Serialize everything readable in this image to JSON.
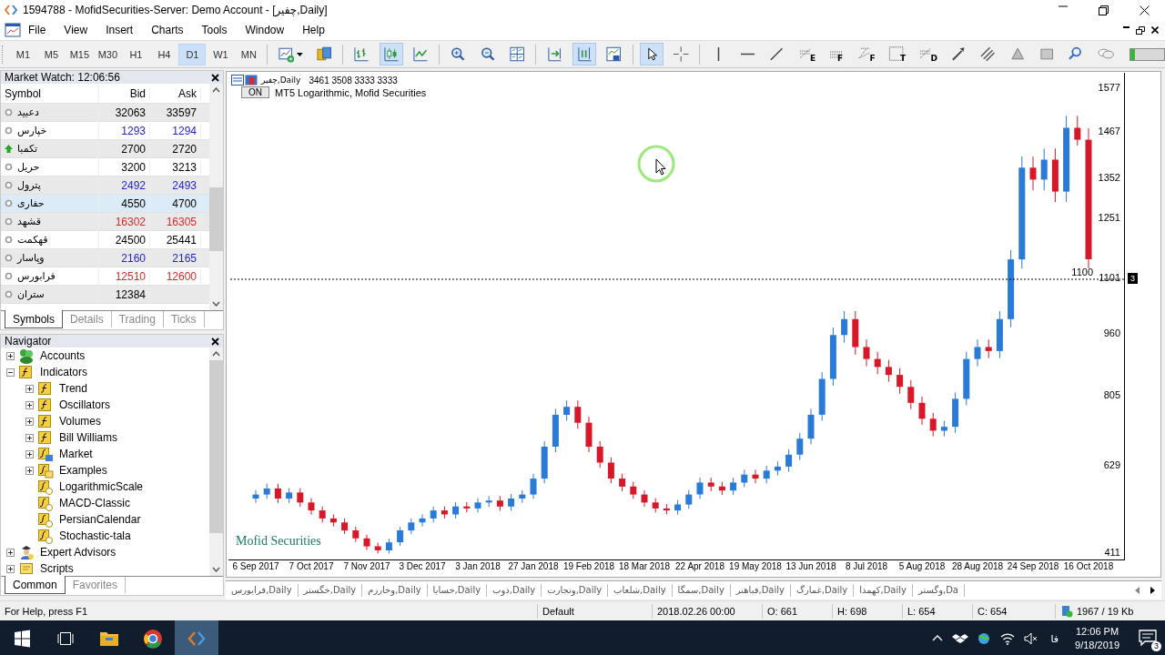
{
  "window": {
    "title": "1594788 - MofidSecurities-Server: Demo Account - [چفیر,Daily]"
  },
  "menu": [
    "File",
    "View",
    "Insert",
    "Charts",
    "Tools",
    "Window",
    "Help"
  ],
  "timeframes": [
    {
      "label": "M1",
      "selected": false
    },
    {
      "label": "M5",
      "selected": false
    },
    {
      "label": "M15",
      "selected": false
    },
    {
      "label": "M30",
      "selected": false
    },
    {
      "label": "H1",
      "selected": false
    },
    {
      "label": "H4",
      "selected": false
    },
    {
      "label": "D1",
      "selected": true
    },
    {
      "label": "W1",
      "selected": false
    },
    {
      "label": "MN",
      "selected": false
    }
  ],
  "toolbar_groups": [
    [
      {
        "kind": "new-chart",
        "selected": false
      },
      {
        "kind": "profiles",
        "selected": false
      }
    ],
    [
      {
        "kind": "bar-chart",
        "selected": false
      },
      {
        "kind": "candle-chart",
        "selected": true
      },
      {
        "kind": "line-chart",
        "selected": false
      }
    ],
    [
      {
        "kind": "zoom-in",
        "selected": false
      },
      {
        "kind": "zoom-out",
        "selected": false
      },
      {
        "kind": "tile",
        "selected": false
      }
    ],
    [
      {
        "kind": "shift",
        "selected": false
      },
      {
        "kind": "autoscroll",
        "selected": true
      },
      {
        "kind": "template",
        "selected": false
      }
    ],
    [
      {
        "kind": "cursor",
        "selected": true
      },
      {
        "kind": "crosshair",
        "selected": false
      }
    ],
    [
      {
        "kind": "vline",
        "selected": false
      },
      {
        "kind": "hline",
        "selected": false
      },
      {
        "kind": "trendline",
        "selected": false
      },
      {
        "kind": "fibo",
        "letter": "E",
        "selected": false
      },
      {
        "kind": "fibo-grid",
        "letter": "F",
        "selected": false
      },
      {
        "kind": "fibo-fan",
        "letter": "F",
        "selected": false
      },
      {
        "kind": "text",
        "letter": "T",
        "selected": false
      },
      {
        "kind": "fibo",
        "letter": "D",
        "selected": false
      },
      {
        "kind": "arrow",
        "selected": false
      },
      {
        "kind": "channel",
        "selected": false
      },
      {
        "kind": "triangle",
        "selected": false
      },
      {
        "kind": "rectangle",
        "selected": false
      },
      {
        "kind": "search",
        "selected": false
      },
      {
        "kind": "chat",
        "selected": false
      }
    ]
  ],
  "market_watch": {
    "title": "Market Watch: 12:06:56",
    "columns": [
      "Symbol",
      "Bid",
      "Ask"
    ],
    "rows": [
      {
        "symbol": "دعبید",
        "bid": "32063",
        "ask": "33597",
        "color": "#000000",
        "kind": "dot",
        "selected": false
      },
      {
        "symbol": "خپارس",
        "bid": "1293",
        "ask": "1294",
        "color": "#2424c8",
        "kind": "dot",
        "selected": false
      },
      {
        "symbol": "تکمبا",
        "bid": "2700",
        "ask": "2720",
        "color": "#000000",
        "kind": "arrow",
        "selected": false
      },
      {
        "symbol": "حریل",
        "bid": "3200",
        "ask": "3213",
        "color": "#000000",
        "kind": "dot",
        "selected": false
      },
      {
        "symbol": "پترول",
        "bid": "2492",
        "ask": "2493",
        "color": "#2424c8",
        "kind": "dot",
        "selected": false
      },
      {
        "symbol": "حفاری",
        "bid": "4550",
        "ask": "4700",
        "color": "#000000",
        "kind": "dot",
        "selected": true
      },
      {
        "symbol": "قشهد",
        "bid": "16302",
        "ask": "16305",
        "color": "#dc2828",
        "kind": "dot",
        "selected": false
      },
      {
        "symbol": "قهکمت",
        "bid": "24500",
        "ask": "25441",
        "color": "#000000",
        "kind": "dot",
        "selected": false
      },
      {
        "symbol": "وپاسار",
        "bid": "2160",
        "ask": "2165",
        "color": "#2424c8",
        "kind": "dot",
        "selected": false
      },
      {
        "symbol": "فرابورس",
        "bid": "12510",
        "ask": "12600",
        "color": "#dc2828",
        "kind": "dot",
        "selected": false
      },
      {
        "symbol": "ستران",
        "bid": "12384",
        "color": "#000000",
        "kind": "dot",
        "selected": false
      }
    ],
    "tabs": [
      {
        "label": "Symbols",
        "selected": true
      },
      {
        "label": "Details",
        "selected": false
      },
      {
        "label": "Trading",
        "selected": false
      },
      {
        "label": "Ticks",
        "selected": false
      }
    ]
  },
  "navigator": {
    "title": "Navigator",
    "items": [
      {
        "label": "Accounts",
        "kind": "accounts",
        "expanded": false
      },
      {
        "label": "Indicators",
        "kind": "indicator",
        "expanded": true,
        "children": [
          {
            "label": "Trend",
            "kind": "indicator",
            "expanded": false
          },
          {
            "label": "Oscillators",
            "kind": "indicator",
            "expanded": false
          },
          {
            "label": "Volumes",
            "kind": "indicator",
            "expanded": false
          },
          {
            "label": "Bill Williams",
            "kind": "indicator",
            "expanded": false
          },
          {
            "label": "Market",
            "kind": "market",
            "expanded": false
          },
          {
            "label": "Examples",
            "kind": "folder",
            "expanded": false
          },
          {
            "label": "LogarithmicScale",
            "kind": "custom"
          },
          {
            "label": "MACD-Classic",
            "kind": "custom"
          },
          {
            "label": "PersianCalendar",
            "kind": "custom"
          },
          {
            "label": "Stochastic-tala",
            "kind": "custom"
          }
        ]
      },
      {
        "label": "Expert Advisors",
        "kind": "experts",
        "expanded": false
      },
      {
        "label": "Scripts",
        "kind": "scripts",
        "expanded": false
      }
    ],
    "tabs": [
      {
        "label": "Common",
        "selected": true
      },
      {
        "label": "Favorites",
        "selected": false
      }
    ]
  },
  "chart": {
    "symbol": "چفیر,Daily",
    "quote": "3461 3508 3333 3333",
    "indicator_button": "ON",
    "indicator_label": "MT5 Logarithmic, Mofid Securities",
    "footer_label": "Mofid Securities",
    "price_line_label": "1100",
    "price_marker": "3",
    "chart_data": {
      "type": "candlestick",
      "categories": [
        "6 Sep 2017",
        null,
        null,
        null,
        null,
        "7 Oct 2017",
        null,
        null,
        null,
        null,
        "7 Nov 2017",
        null,
        null,
        null,
        null,
        "3 Dec 2017",
        null,
        null,
        null,
        null,
        "3 Jan 2018",
        null,
        null,
        null,
        null,
        "27 Jan 2018",
        null,
        null,
        null,
        null,
        "19 Feb 2018",
        null,
        null,
        null,
        null,
        "18 Mar 2018",
        null,
        null,
        null,
        null,
        "22 Apr 2018",
        null,
        null,
        null,
        null,
        "19 May 2018",
        null,
        null,
        null,
        null,
        "13 Jun 2018",
        null,
        null,
        null,
        null,
        "8 Jul 2018",
        null,
        null,
        null,
        null,
        "5 Aug 2018",
        null,
        null,
        null,
        null,
        "28 Aug 2018",
        null,
        null,
        null,
        null,
        "24 Sep 2018",
        null,
        null,
        null,
        null,
        "16 Oct 2018"
      ],
      "ohlc": [
        [
          550,
          571,
          539,
          560
        ],
        [
          560,
          587,
          549,
          575
        ],
        [
          575,
          587,
          539,
          550
        ],
        [
          550,
          576,
          539,
          565
        ],
        [
          565,
          576,
          529,
          540
        ],
        [
          540,
          551,
          510,
          520
        ],
        [
          520,
          530,
          490,
          500
        ],
        [
          500,
          510,
          480,
          490
        ],
        [
          490,
          500,
          461,
          470
        ],
        [
          470,
          479,
          441,
          450
        ],
        [
          450,
          459,
          421,
          430
        ],
        [
          430,
          439,
          412,
          420
        ],
        [
          420,
          449,
          412,
          440
        ],
        [
          440,
          479,
          431,
          470
        ],
        [
          470,
          500,
          461,
          490
        ],
        [
          490,
          510,
          480,
          500
        ],
        [
          500,
          530,
          490,
          520
        ],
        [
          520,
          530,
          500,
          510
        ],
        [
          510,
          541,
          500,
          530
        ],
        [
          530,
          541,
          515,
          525
        ],
        [
          525,
          551,
          515,
          540
        ],
        [
          540,
          556,
          529,
          545
        ],
        [
          545,
          556,
          519,
          530
        ],
        [
          530,
          561,
          519,
          550
        ],
        [
          550,
          571,
          539,
          560
        ],
        [
          560,
          612,
          549,
          600
        ],
        [
          600,
          694,
          588,
          680
        ],
        [
          680,
          775,
          666,
          760
        ],
        [
          760,
          796,
          745,
          780
        ],
        [
          780,
          796,
          725,
          740
        ],
        [
          740,
          755,
          666,
          680
        ],
        [
          680,
          694,
          627,
          640
        ],
        [
          640,
          653,
          588,
          600
        ],
        [
          600,
          612,
          568,
          580
        ],
        [
          580,
          592,
          549,
          560
        ],
        [
          560,
          571,
          529,
          540
        ],
        [
          540,
          551,
          515,
          525
        ],
        [
          525,
          536,
          510,
          520
        ],
        [
          520,
          546,
          510,
          535
        ],
        [
          535,
          571,
          524,
          560
        ],
        [
          560,
          602,
          549,
          590
        ],
        [
          590,
          602,
          568,
          580
        ],
        [
          580,
          592,
          559,
          570
        ],
        [
          570,
          602,
          559,
          590
        ],
        [
          590,
          622,
          578,
          610
        ],
        [
          610,
          622,
          588,
          600
        ],
        [
          600,
          632,
          588,
          620
        ],
        [
          620,
          643,
          608,
          630
        ],
        [
          630,
          673,
          617,
          660
        ],
        [
          660,
          714,
          647,
          700
        ],
        [
          700,
          775,
          686,
          760
        ],
        [
          760,
          867,
          745,
          850
        ],
        [
          850,
          979,
          833,
          960
        ],
        [
          960,
          1020,
          941,
          1000
        ],
        [
          1000,
          1020,
          911,
          930
        ],
        [
          930,
          949,
          882,
          900
        ],
        [
          900,
          918,
          862,
          880
        ],
        [
          880,
          898,
          843,
          860
        ],
        [
          860,
          877,
          813,
          830
        ],
        [
          830,
          847,
          774,
          790
        ],
        [
          790,
          806,
          735,
          750
        ],
        [
          750,
          765,
          706,
          720
        ],
        [
          720,
          745,
          706,
          730
        ],
        [
          730,
          816,
          715,
          800
        ],
        [
          800,
          918,
          784,
          900
        ],
        [
          900,
          949,
          882,
          930
        ],
        [
          930,
          949,
          902,
          920
        ],
        [
          920,
          1020,
          902,
          1000
        ],
        [
          1000,
          1173,
          980,
          1150
        ],
        [
          1150,
          1408,
          1127,
          1380
        ],
        [
          1380,
          1408,
          1323,
          1350
        ],
        [
          1350,
          1428,
          1323,
          1400
        ],
        [
          1400,
          1428,
          1294,
          1320
        ],
        [
          1320,
          1510,
          1294,
          1480
        ],
        [
          1480,
          1510,
          1435,
          1450
        ],
        [
          1450,
          1479,
          1127,
          1150
        ]
      ],
      "ylim": [
        397,
        1618
      ],
      "yticks": [
        {
          "value": 1577,
          "label": "1577"
        },
        {
          "value": 1467,
          "label": "1467"
        },
        {
          "value": 1352,
          "label": "1352"
        },
        {
          "value": 1251,
          "label": "1251"
        },
        {
          "value": 1101,
          "label": "1101"
        },
        {
          "value": 960,
          "label": "960"
        },
        {
          "value": 805,
          "label": "805"
        },
        {
          "value": 629,
          "label": "629"
        },
        {
          "value": 411,
          "label": "411"
        }
      ]
    }
  },
  "chart_tabs": [
    "فرابورس,Daily",
    "خگستر,Daily",
    "وخارزم,Daily",
    "خسایا,Daily",
    "ذوب,Daily",
    "وتجارت,Daily",
    "شلعاب,Daily",
    "سمگا,Daily",
    "فباهنر,Daily",
    "غمارگ,Daily",
    "کهمدا,Daily",
    "وگستر,Da"
  ],
  "status_bar": {
    "help": "For Help, press F1",
    "profile": "Default",
    "time": "2018.02.26 00:00",
    "open": "O: 661",
    "high": "H: 698",
    "low": "L: 654",
    "close": "C: 654",
    "traffic": "1967 / 19 Kb"
  },
  "taskbar": {
    "language": "فا",
    "time": "12:06 PM",
    "date": "9/18/2019",
    "notifications": "3"
  }
}
